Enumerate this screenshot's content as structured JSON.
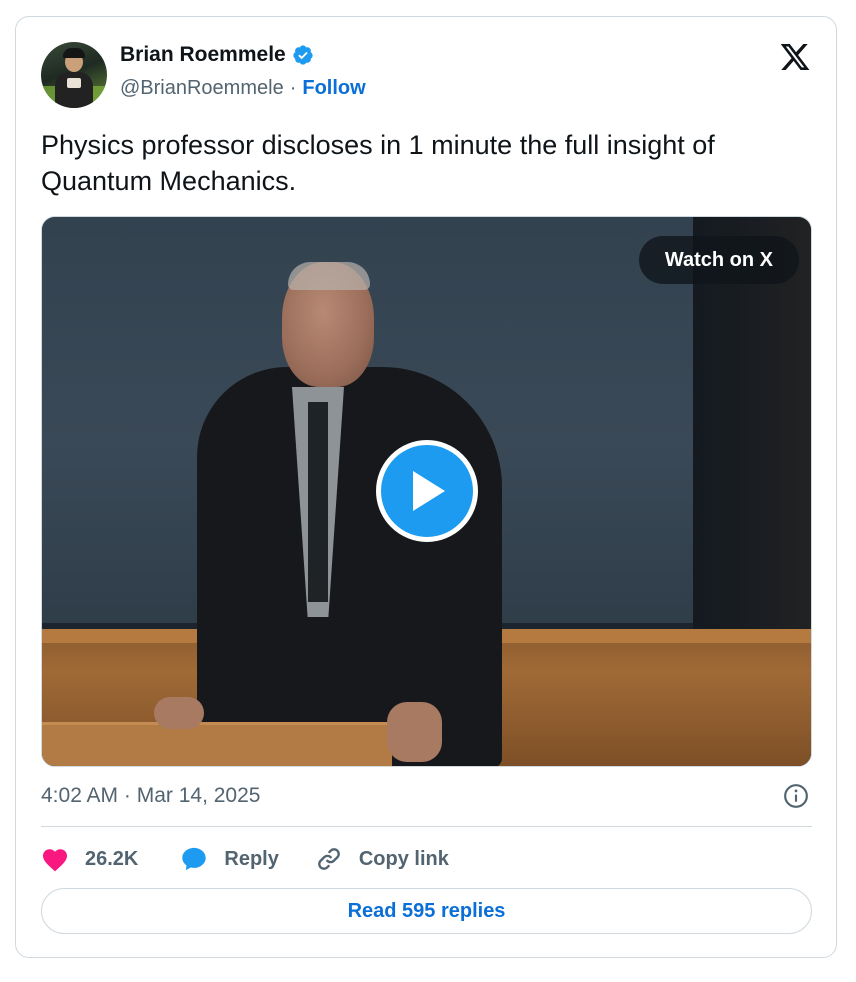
{
  "author": {
    "display_name": "Brian Roemmele",
    "handle": "@BrianRoemmele",
    "separator": "·",
    "follow_label": "Follow",
    "verified": true
  },
  "tweet": {
    "text": "Physics professor discloses in 1 minute the full insight of Quantum Mechanics.",
    "timestamp": "4:02 AM · Mar 14, 2025"
  },
  "media": {
    "type": "video",
    "watch_label": "Watch on X"
  },
  "actions": {
    "likes_count": "26.2K",
    "reply_label": "Reply",
    "copy_link_label": "Copy link"
  },
  "read_replies_label": "Read 595 replies",
  "icons": {
    "brand": "x-logo-icon",
    "verified": "verified-badge-icon",
    "info": "info-icon",
    "like": "heart-icon",
    "reply": "speech-bubble-icon",
    "copy": "link-icon",
    "play": "play-icon"
  },
  "colors": {
    "accent_blue": "#1d9bf0",
    "link_blue": "#0a6fd6",
    "like_pink": "#f91880",
    "secondary_text": "#536471",
    "border": "#cfd9de"
  }
}
